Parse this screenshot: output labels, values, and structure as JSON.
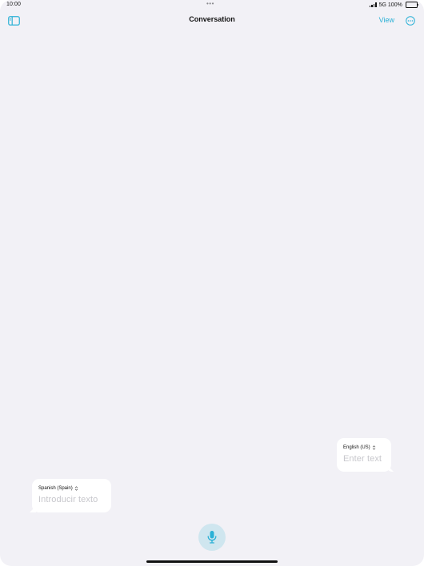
{
  "status_bar": {
    "time": "10:00",
    "dots": "•••",
    "network": "5G",
    "battery": "100%"
  },
  "nav": {
    "title": "Conversation",
    "view_label": "View",
    "icons": {
      "sidebar": "sidebar-toggle-icon",
      "more": "ellipsis-circle-icon"
    }
  },
  "bubbles": {
    "english": {
      "language": "English (US)",
      "placeholder": "Enter text"
    },
    "spanish": {
      "language": "Spanish (Spain)",
      "placeholder": "Introducir texto"
    }
  },
  "colors": {
    "accent": "#2bb1d6",
    "background": "#f2f1f6",
    "mic_background": "#cfe6ef",
    "placeholder": "#c7c7cc"
  }
}
